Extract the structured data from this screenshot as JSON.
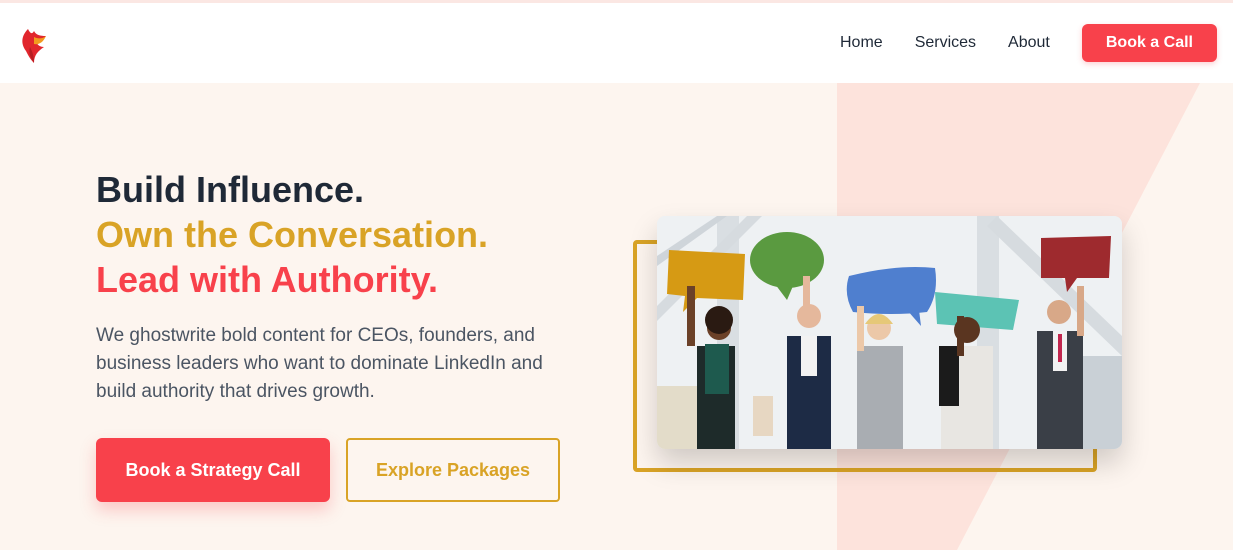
{
  "brand": {
    "logo_icon": "phoenix-logo-icon",
    "accent": "#f8414b",
    "gold": "#d9a326",
    "dark": "#1f2937"
  },
  "nav": {
    "items": [
      {
        "label": "Home"
      },
      {
        "label": "Services"
      },
      {
        "label": "About"
      }
    ],
    "cta_label": "Book a Call"
  },
  "hero": {
    "headline_line1": "Build Influence.",
    "headline_line2": "Own the Conversation.",
    "headline_line3": "Lead with Authority.",
    "subtext": "We ghostwrite bold content for CEOs, founders, and business leaders who want to dominate LinkedIn and build authority that drives growth.",
    "primary_cta": "Book a Strategy Call",
    "secondary_cta": "Explore Packages",
    "image_icon": "team-speech-bubbles-photo"
  }
}
